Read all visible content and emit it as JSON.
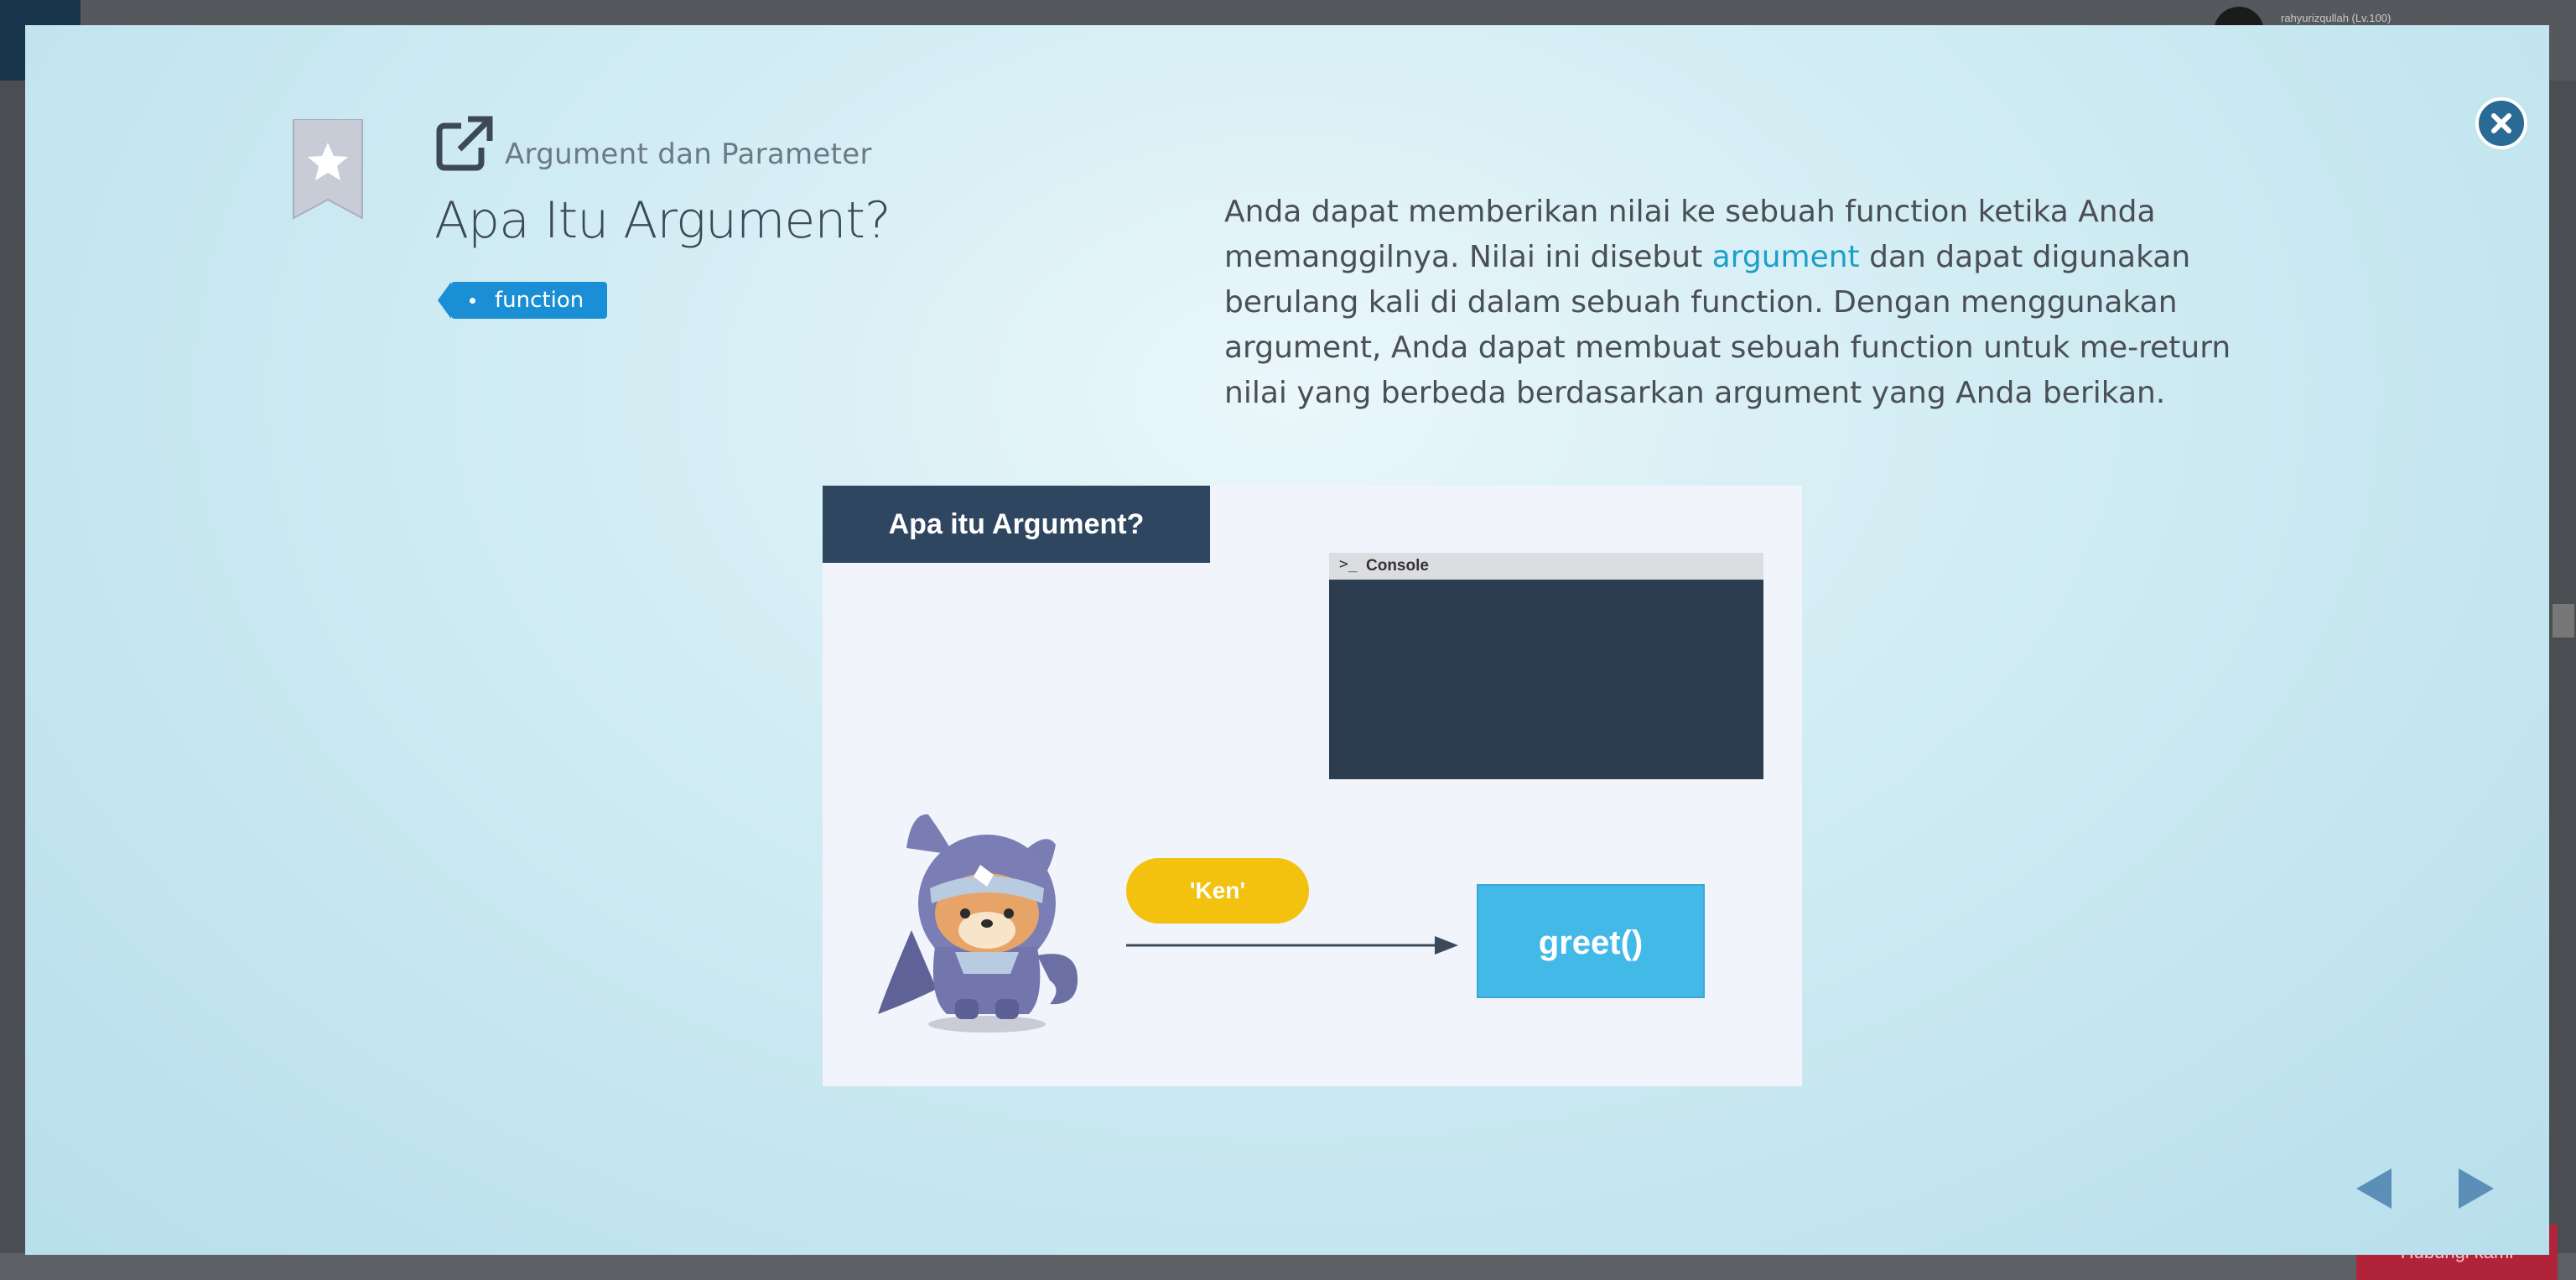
{
  "background": {
    "user_name": "rahyurizqullah (Lv.100)",
    "bottom_button": "Hubungi kami"
  },
  "modal": {
    "subtitle": "Argument dan Parameter",
    "title": "Apa Itu Argument?",
    "tag": "function",
    "description": {
      "part1": "Anda dapat memberikan nilai ke sebuah function ketika Anda memanggilnya. Nilai ini disebut ",
      "highlight": "argument",
      "part2": " dan dapat digunakan berulang kali di dalam sebuah function. Dengan menggunakan argument, Anda dapat membuat sebuah function untuk me-return nilai yang berbeda berdasarkan argument yang Anda berikan."
    },
    "illustration": {
      "title": "Apa itu Argument?",
      "console_label": "Console",
      "console_prompt": ">_",
      "argument_value": "'Ken'",
      "function_call": "greet()"
    }
  },
  "colors": {
    "accent": "#1a8fd6",
    "highlight": "#1aa0c8",
    "close_button": "#2a6b96",
    "nav_arrow": "#5b8fb8"
  },
  "icons": [
    "close-icon",
    "bookmark-star-icon",
    "external-link-icon",
    "prev-arrow-icon",
    "next-arrow-icon"
  ]
}
